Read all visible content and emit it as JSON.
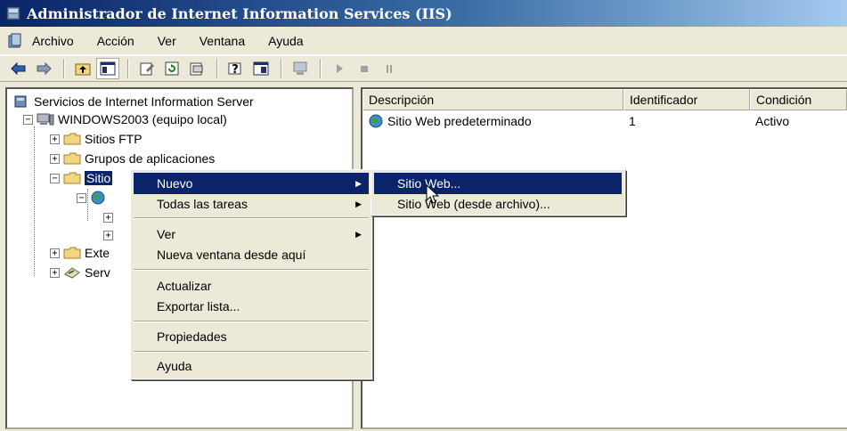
{
  "window": {
    "title": "Administrador de Internet Information Services (IIS)"
  },
  "menubar": {
    "items": [
      "Archivo",
      "Acción",
      "Ver",
      "Ventana",
      "Ayuda"
    ]
  },
  "tree": {
    "root": "Servicios de Internet Information Server",
    "server": "WINDOWS2003 (equipo local)",
    "ftp": "Sitios FTP",
    "app_pools": "Grupos de aplicaciones",
    "web_sites": "Sitio",
    "ext": "Exte",
    "serv": "Serv"
  },
  "list": {
    "columns": [
      "Descripción",
      "Identificador",
      "Condición"
    ],
    "rows": [
      {
        "description": "Sitio Web predeterminado",
        "id": "1",
        "status": "Activo"
      }
    ]
  },
  "context_menu": {
    "items": {
      "nuevo": "Nuevo",
      "todas": "Todas las tareas",
      "ver": "Ver",
      "nueva_ventana": "Nueva ventana desde aquí",
      "actualizar": "Actualizar",
      "exportar": "Exportar lista...",
      "propiedades": "Propiedades",
      "ayuda": "Ayuda"
    }
  },
  "submenu": {
    "items": {
      "sitio_web": "Sitio Web...",
      "sitio_web_archivo": "Sitio Web (desde archivo)..."
    }
  },
  "colors": {
    "title_start": "#0a246a",
    "title_end": "#a6caf0",
    "highlight": "#0a246a",
    "face": "#ece9d8"
  },
  "icons": [
    "iis-icon",
    "back-arrow-icon",
    "forward-arrow-icon",
    "up-folder-icon",
    "show-tree-icon",
    "properties-icon",
    "refresh-icon",
    "export-icon",
    "help-icon",
    "console-icon",
    "computer-icon",
    "play-icon",
    "stop-icon",
    "pause-icon",
    "folder-icon",
    "globe-icon"
  ]
}
